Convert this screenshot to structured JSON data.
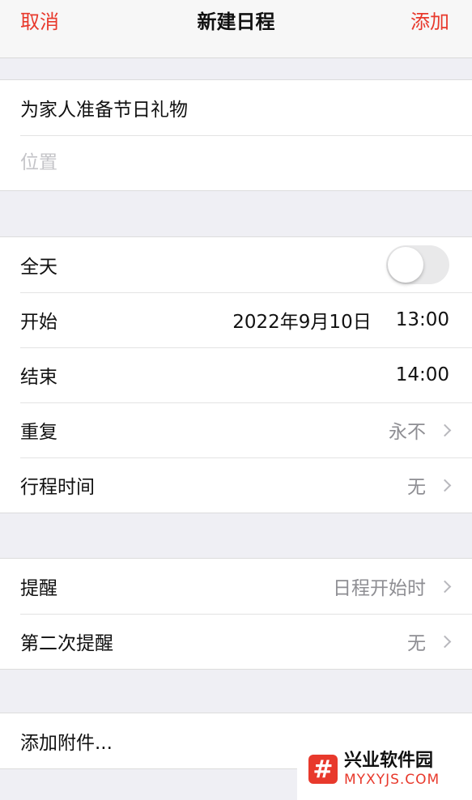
{
  "navbar": {
    "cancel_label": "取消",
    "title": "新建日程",
    "add_label": "添加"
  },
  "event": {
    "title_value": "为家人准备节日礼物",
    "location_placeholder": "位置"
  },
  "time_section": {
    "all_day_label": "全天",
    "all_day_on": false,
    "start_label": "开始",
    "start_date": "2022年9月10日",
    "start_time": "13:00",
    "end_label": "结束",
    "end_time": "14:00",
    "repeat_label": "重复",
    "repeat_value": "永不",
    "travel_label": "行程时间",
    "travel_value": "无"
  },
  "alert_section": {
    "alert_label": "提醒",
    "alert_value": "日程开始时",
    "second_alert_label": "第二次提醒",
    "second_alert_value": "无"
  },
  "attachment": {
    "label": "添加附件..."
  },
  "watermark": {
    "logo_glyph": "#",
    "name": "兴业软件园",
    "site": "MYXYJS.COM"
  },
  "colors": {
    "accent": "#e8392c",
    "secondary_text": "#8e8e93",
    "background": "#efeff4"
  }
}
